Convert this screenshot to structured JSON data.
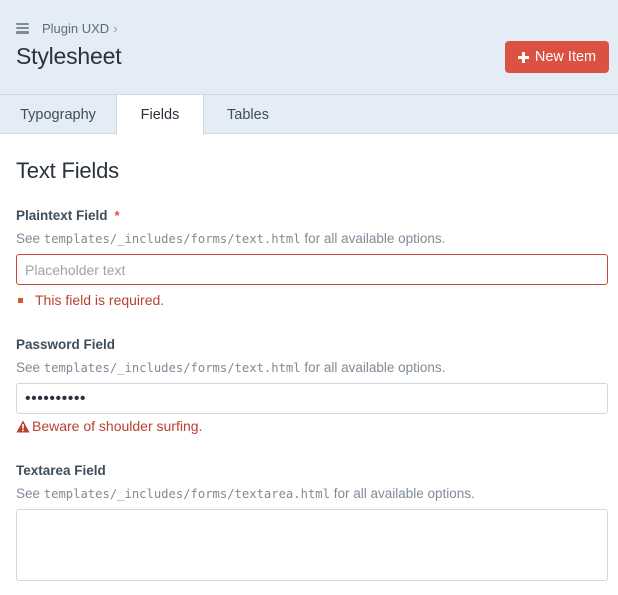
{
  "header": {
    "breadcrumb": "Plugin UXD",
    "breadcrumb_sep": "›",
    "title": "Stylesheet",
    "new_item_label": "New Item"
  },
  "tabs": [
    {
      "label": "Typography",
      "active": false
    },
    {
      "label": "Fields",
      "active": true
    },
    {
      "label": "Tables",
      "active": false
    }
  ],
  "section_title": "Text Fields",
  "fields": {
    "plaintext": {
      "label": "Plaintext Field",
      "required_mark": "*",
      "help_prefix": "See ",
      "help_code": "templates/_includes/forms/text.html",
      "help_suffix": " for all available options.",
      "placeholder": "Placeholder text",
      "value": "",
      "error": "This field is required."
    },
    "password": {
      "label": "Password Field",
      "help_prefix": "See ",
      "help_code": "templates/_includes/forms/text.html",
      "help_suffix": " for all available options.",
      "value": "••••••••••",
      "warning": "Beware of shoulder surfing."
    },
    "textarea": {
      "label": "Textarea Field",
      "help_prefix": "See ",
      "help_code": "templates/_includes/forms/textarea.html",
      "help_suffix": " for all available options.",
      "value": ""
    }
  },
  "colors": {
    "header_bg": "#e4edf6",
    "accent": "#db5142",
    "error_text": "#b9412f",
    "text": "#29323d",
    "muted": "#7f8b97"
  },
  "icons": {
    "menu": "hamburger-menu-icon",
    "add": "plus-icon",
    "warning": "warning-triangle-icon",
    "error_bullet": "square-bullet-icon"
  }
}
